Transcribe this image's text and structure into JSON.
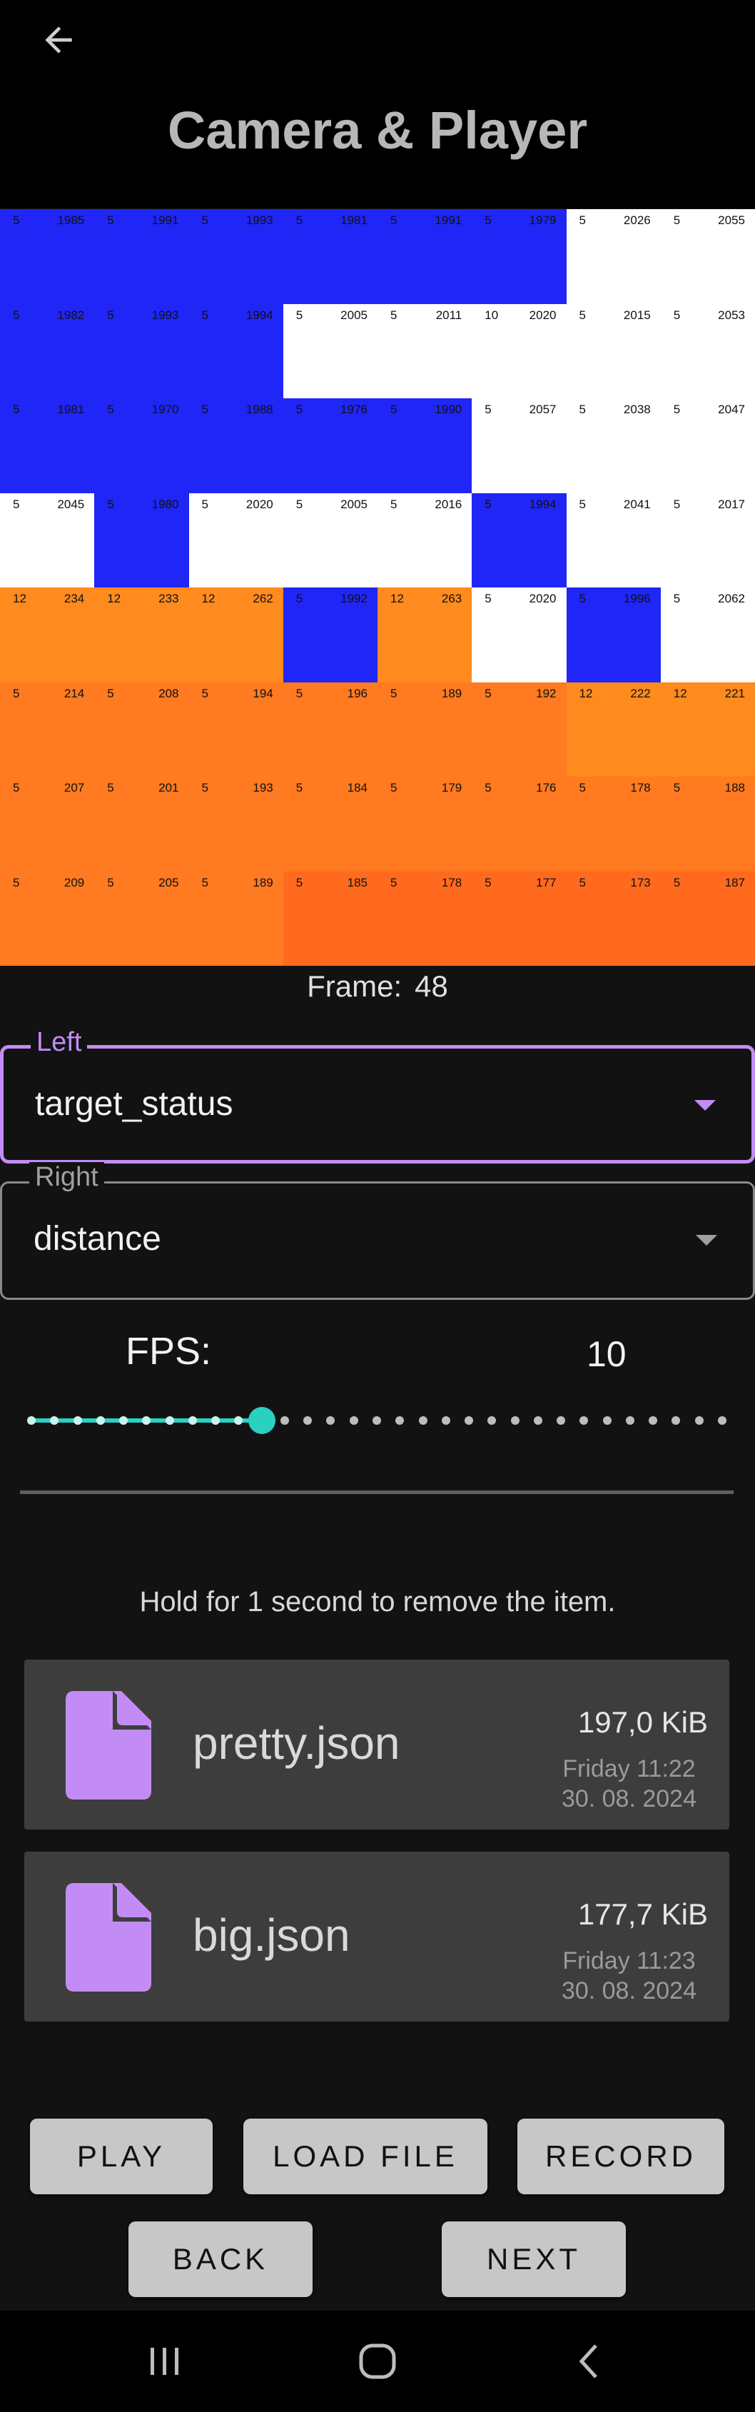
{
  "app": {
    "title": "Camera & Player",
    "back_icon": "arrow-left-icon"
  },
  "colors": {
    "blue": "#1f26f5",
    "white": "#ffffff",
    "orange_light": "#ff8a1e",
    "orange": "#ff7a20",
    "orange_dark": "#ff6a1e",
    "accent_purple": "#c38cf4",
    "accent_teal": "#2ad1c1"
  },
  "grid": {
    "rows": [
      [
        {
          "a": "5",
          "b": "1985",
          "color": "blue"
        },
        {
          "a": "5",
          "b": "1991",
          "color": "blue"
        },
        {
          "a": "5",
          "b": "1993",
          "color": "blue"
        },
        {
          "a": "5",
          "b": "1981",
          "color": "blue"
        },
        {
          "a": "5",
          "b": "1991",
          "color": "blue"
        },
        {
          "a": "5",
          "b": "1979",
          "color": "blue"
        },
        {
          "a": "5",
          "b": "2026",
          "color": "white"
        },
        {
          "a": "5",
          "b": "2055",
          "color": "white"
        }
      ],
      [
        {
          "a": "5",
          "b": "1982",
          "color": "blue"
        },
        {
          "a": "5",
          "b": "1993",
          "color": "blue"
        },
        {
          "a": "5",
          "b": "1994",
          "color": "blue"
        },
        {
          "a": "5",
          "b": "2005",
          "color": "white"
        },
        {
          "a": "5",
          "b": "2011",
          "color": "white"
        },
        {
          "a": "10",
          "b": "2020",
          "color": "white"
        },
        {
          "a": "5",
          "b": "2015",
          "color": "white"
        },
        {
          "a": "5",
          "b": "2053",
          "color": "white"
        }
      ],
      [
        {
          "a": "5",
          "b": "1981",
          "color": "blue"
        },
        {
          "a": "5",
          "b": "1970",
          "color": "blue"
        },
        {
          "a": "5",
          "b": "1988",
          "color": "blue"
        },
        {
          "a": "5",
          "b": "1976",
          "color": "blue"
        },
        {
          "a": "5",
          "b": "1990",
          "color": "blue"
        },
        {
          "a": "5",
          "b": "2057",
          "color": "white"
        },
        {
          "a": "5",
          "b": "2038",
          "color": "white"
        },
        {
          "a": "5",
          "b": "2047",
          "color": "white"
        }
      ],
      [
        {
          "a": "5",
          "b": "2045",
          "color": "white"
        },
        {
          "a": "5",
          "b": "1980",
          "color": "blue"
        },
        {
          "a": "5",
          "b": "2020",
          "color": "white"
        },
        {
          "a": "5",
          "b": "2005",
          "color": "white"
        },
        {
          "a": "5",
          "b": "2016",
          "color": "white"
        },
        {
          "a": "5",
          "b": "1994",
          "color": "blue"
        },
        {
          "a": "5",
          "b": "2041",
          "color": "white"
        },
        {
          "a": "5",
          "b": "2017",
          "color": "white"
        }
      ],
      [
        {
          "a": "12",
          "b": "234",
          "color": "orange_light"
        },
        {
          "a": "12",
          "b": "233",
          "color": "orange_light"
        },
        {
          "a": "12",
          "b": "262",
          "color": "orange_light"
        },
        {
          "a": "5",
          "b": "1992",
          "color": "blue"
        },
        {
          "a": "12",
          "b": "263",
          "color": "orange_light"
        },
        {
          "a": "5",
          "b": "2020",
          "color": "white"
        },
        {
          "a": "5",
          "b": "1996",
          "color": "blue"
        },
        {
          "a": "5",
          "b": "2062",
          "color": "white"
        }
      ],
      [
        {
          "a": "5",
          "b": "214",
          "color": "orange"
        },
        {
          "a": "5",
          "b": "208",
          "color": "orange"
        },
        {
          "a": "5",
          "b": "194",
          "color": "orange"
        },
        {
          "a": "5",
          "b": "196",
          "color": "orange"
        },
        {
          "a": "5",
          "b": "189",
          "color": "orange"
        },
        {
          "a": "5",
          "b": "192",
          "color": "orange"
        },
        {
          "a": "12",
          "b": "222",
          "color": "orange_light"
        },
        {
          "a": "12",
          "b": "221",
          "color": "orange_light"
        }
      ],
      [
        {
          "a": "5",
          "b": "207",
          "color": "orange"
        },
        {
          "a": "5",
          "b": "201",
          "color": "orange"
        },
        {
          "a": "5",
          "b": "193",
          "color": "orange"
        },
        {
          "a": "5",
          "b": "184",
          "color": "orange"
        },
        {
          "a": "5",
          "b": "179",
          "color": "orange"
        },
        {
          "a": "5",
          "b": "176",
          "color": "orange"
        },
        {
          "a": "5",
          "b": "178",
          "color": "orange"
        },
        {
          "a": "5",
          "b": "188",
          "color": "orange"
        }
      ],
      [
        {
          "a": "5",
          "b": "209",
          "color": "orange"
        },
        {
          "a": "5",
          "b": "205",
          "color": "orange"
        },
        {
          "a": "5",
          "b": "189",
          "color": "orange"
        },
        {
          "a": "5",
          "b": "185",
          "color": "orange_dark"
        },
        {
          "a": "5",
          "b": "178",
          "color": "orange_dark"
        },
        {
          "a": "5",
          "b": "177",
          "color": "orange_dark"
        },
        {
          "a": "5",
          "b": "173",
          "color": "orange_dark"
        },
        {
          "a": "5",
          "b": "187",
          "color": "orange_dark"
        }
      ]
    ]
  },
  "frame": {
    "label": "Frame:",
    "value": "48"
  },
  "selects": {
    "left": {
      "label": "Left",
      "value": "target_status",
      "icon": "caret-down-icon"
    },
    "right": {
      "label": "Right",
      "value": "distance",
      "icon": "caret-down-icon"
    }
  },
  "fps": {
    "label": "FPS:",
    "value": "10",
    "slider_steps": 31,
    "slider_index": 10
  },
  "hint": "Hold for 1 second to remove the item.",
  "files": [
    {
      "name": "pretty.json",
      "size": "197,0 KiB",
      "day_time": "Friday 11:22",
      "date": "30. 08. 2024",
      "icon": "file-icon"
    },
    {
      "name": "big.json",
      "size": "177,7 KiB",
      "day_time": "Friday 11:23",
      "date": "30. 08. 2024",
      "icon": "file-icon"
    }
  ],
  "buttons": {
    "play": "PLAY",
    "load_file": "LOAD FILE",
    "record": "RECORD",
    "back": "BACK",
    "next": "NEXT"
  },
  "navbar": {
    "recents_icon": "recents-icon",
    "home_icon": "home-icon",
    "back_icon": "back-chevron-icon"
  }
}
